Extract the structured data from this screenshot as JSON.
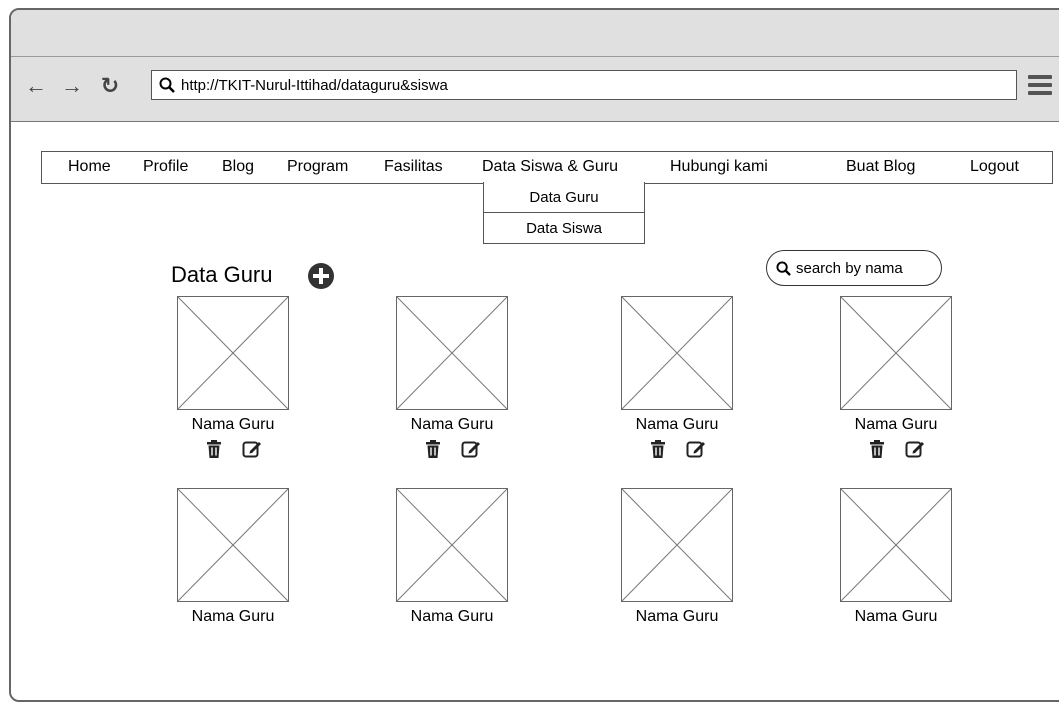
{
  "browser": {
    "url": "http://TKIT-Nurul-Ittihad/dataguru&siswa"
  },
  "nav": {
    "items": [
      "Home",
      "Profile",
      "Blog",
      "Program",
      "Fasilitas",
      "Data Siswa & Guru",
      "Hubungi kami",
      "Buat Blog",
      "Logout"
    ],
    "dropdown": [
      "Data Guru",
      "Data Siswa"
    ]
  },
  "main": {
    "title": "Data Guru",
    "search_placeholder": "search by nama"
  },
  "cards": [
    {
      "name": "Nama Guru",
      "actions": true
    },
    {
      "name": "Nama Guru",
      "actions": true
    },
    {
      "name": "Nama Guru",
      "actions": true
    },
    {
      "name": "Nama Guru",
      "actions": true
    },
    {
      "name": "Nama Guru",
      "actions": false
    },
    {
      "name": "Nama Guru",
      "actions": false
    },
    {
      "name": "Nama Guru",
      "actions": false
    },
    {
      "name": "Nama Guru",
      "actions": false
    }
  ],
  "icons": {
    "back": "back-arrow-icon",
    "forward": "forward-arrow-icon",
    "reload": "reload-icon",
    "search": "search-icon",
    "menu": "hamburger-menu-icon",
    "add": "plus-circle-icon",
    "delete": "trash-icon",
    "edit": "edit-icon",
    "photo": "image-placeholder-icon"
  }
}
